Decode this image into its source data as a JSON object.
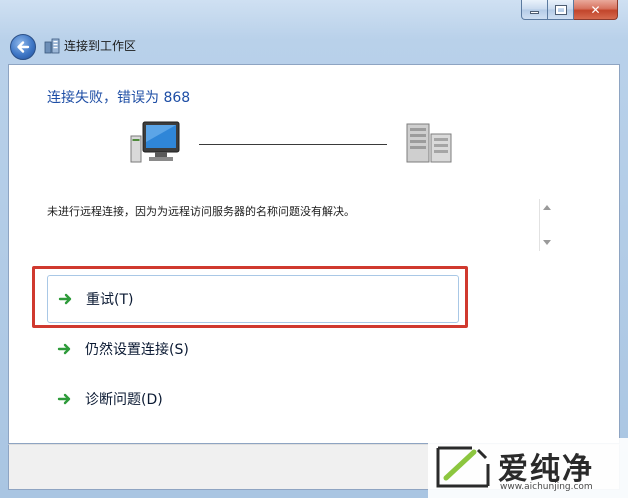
{
  "window": {
    "title": "连接到工作区",
    "controls": [
      "minimize",
      "maximize",
      "close"
    ]
  },
  "icons": {
    "back": "back-arrow-icon",
    "title": "workplace-connection-icon",
    "computer": "computer-icon",
    "server": "server-icon",
    "option_arrow": "green-arrow-icon"
  },
  "content": {
    "heading": "连接失败，错误为 868",
    "message": "未进行远程连接，因为为远程访问服务器的名称问题没有解决。",
    "options": [
      {
        "label": "重试(T)"
      },
      {
        "label": "仍然设置连接(S)"
      },
      {
        "label": "诊断问题(D)"
      }
    ]
  },
  "watermark": {
    "brand": "爱纯净",
    "url": "www.aichunjing.com"
  },
  "colors": {
    "heading": "#1e4ea5",
    "highlight": "#d0392f",
    "arrow": "#2e9b3a"
  }
}
